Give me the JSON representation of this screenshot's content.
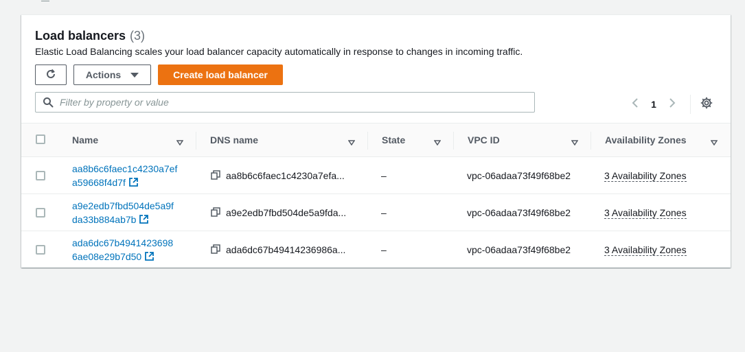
{
  "panel": {
    "title": "Load balancers",
    "count": "(3)",
    "description": "Elastic Load Balancing scales your load balancer capacity automatically in response to changes in incoming traffic."
  },
  "toolbar": {
    "refresh_icon": "refresh-icon",
    "actions_label": "Actions",
    "create_label": "Create load balancer",
    "primary_color": "#ec7211"
  },
  "filter": {
    "placeholder": "Filter by property or value",
    "value": ""
  },
  "pagination": {
    "current_page": "1"
  },
  "table": {
    "columns": [
      "Name",
      "DNS name",
      "State",
      "VPC ID",
      "Availability Zones"
    ],
    "rows": [
      {
        "name_line1": "aa8b6c6faec1c4230a7ef",
        "name_line2": "a59668f4d7f",
        "dns": "aa8b6c6faec1c4230a7efa...",
        "state": "–",
        "vpc": "vpc-06adaa73f49f68be2",
        "az": "3 Availability Zones"
      },
      {
        "name_line1": "a9e2edb7fbd504de5a9f",
        "name_line2": "da33b884ab7b",
        "dns": "a9e2edb7fbd504de5a9fda...",
        "state": "–",
        "vpc": "vpc-06adaa73f49f68be2",
        "az": "3 Availability Zones"
      },
      {
        "name_line1": "ada6dc67b4941423698",
        "name_line2": "6ae08e29b7d50",
        "dns": "ada6dc67b49414236986a...",
        "state": "–",
        "vpc": "vpc-06adaa73f49f68be2",
        "az": "3 Availability Zones"
      }
    ]
  },
  "colors": {
    "link": "#0073bb",
    "page_bg": "#f2f3f3"
  }
}
